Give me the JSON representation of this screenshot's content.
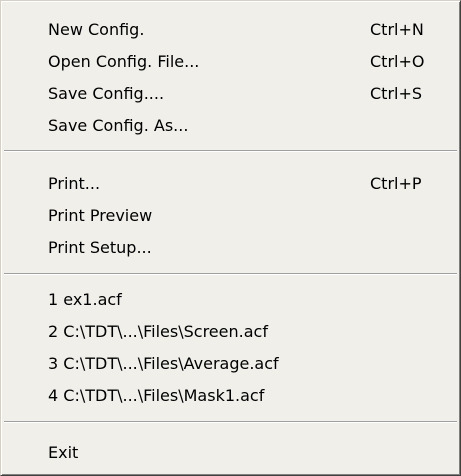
{
  "menu": {
    "items": [
      {
        "label": "New Config.",
        "shortcut": "Ctrl+N"
      },
      {
        "label": "Open Config. File...",
        "shortcut": "Ctrl+O"
      },
      {
        "label": "Save Config....",
        "shortcut": "Ctrl+S"
      },
      {
        "label": "Save Config. As...",
        "shortcut": ""
      },
      {
        "label": "Print...",
        "shortcut": "Ctrl+P"
      },
      {
        "label": "Print Preview",
        "shortcut": ""
      },
      {
        "label": "Print Setup...",
        "shortcut": ""
      },
      {
        "label": "1 ex1.acf",
        "shortcut": ""
      },
      {
        "label": "2 C:\\TDT\\...\\Files\\Screen.acf",
        "shortcut": ""
      },
      {
        "label": "3 C:\\TDT\\...\\Files\\Average.acf",
        "shortcut": ""
      },
      {
        "label": "4 C:\\TDT\\...\\Files\\Mask1.acf",
        "shortcut": ""
      },
      {
        "label": "Exit",
        "shortcut": ""
      }
    ]
  }
}
